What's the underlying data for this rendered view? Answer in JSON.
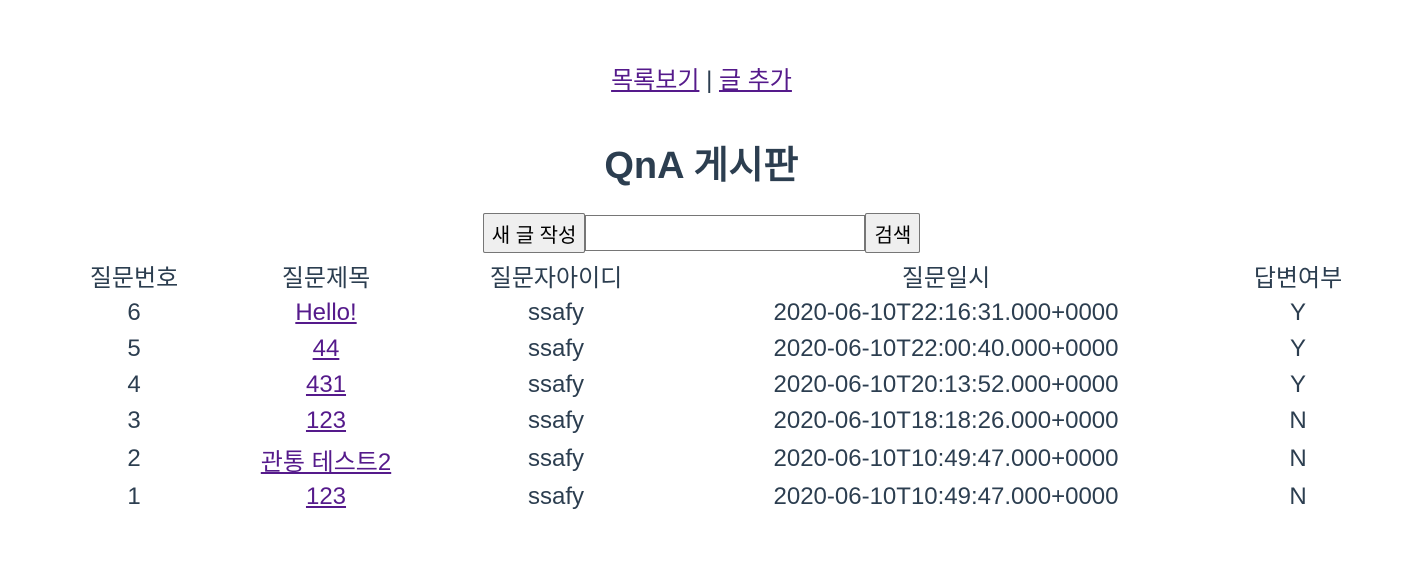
{
  "nav": {
    "list_label": "목록보기",
    "separator": "|",
    "add_label": "글 추가"
  },
  "title": "QnA 게시판",
  "toolbar": {
    "new_post_label": "새 글 작성",
    "search_value": "",
    "search_label": "검색"
  },
  "table": {
    "headers": [
      "질문번호",
      "질문제목",
      "질문자아이디",
      "질문일시",
      "답변여부"
    ],
    "rows": [
      {
        "no": "6",
        "title": "Hello!",
        "user": "ssafy",
        "date": "2020-06-10T22:16:31.000+0000",
        "answered": "Y"
      },
      {
        "no": "5",
        "title": "44",
        "user": "ssafy",
        "date": "2020-06-10T22:00:40.000+0000",
        "answered": "Y"
      },
      {
        "no": "4",
        "title": "431",
        "user": "ssafy",
        "date": "2020-06-10T20:13:52.000+0000",
        "answered": "Y"
      },
      {
        "no": "3",
        "title": "123",
        "user": "ssafy",
        "date": "2020-06-10T18:18:26.000+0000",
        "answered": "N"
      },
      {
        "no": "2",
        "title": "관통 테스트2",
        "user": "ssafy",
        "date": "2020-06-10T10:49:47.000+0000",
        "answered": "N"
      },
      {
        "no": "1",
        "title": "123",
        "user": "ssafy",
        "date": "2020-06-10T10:49:47.000+0000",
        "answered": "N"
      }
    ]
  },
  "colors": {
    "text": "#2c3e50",
    "link_visited": "#551a8b"
  }
}
